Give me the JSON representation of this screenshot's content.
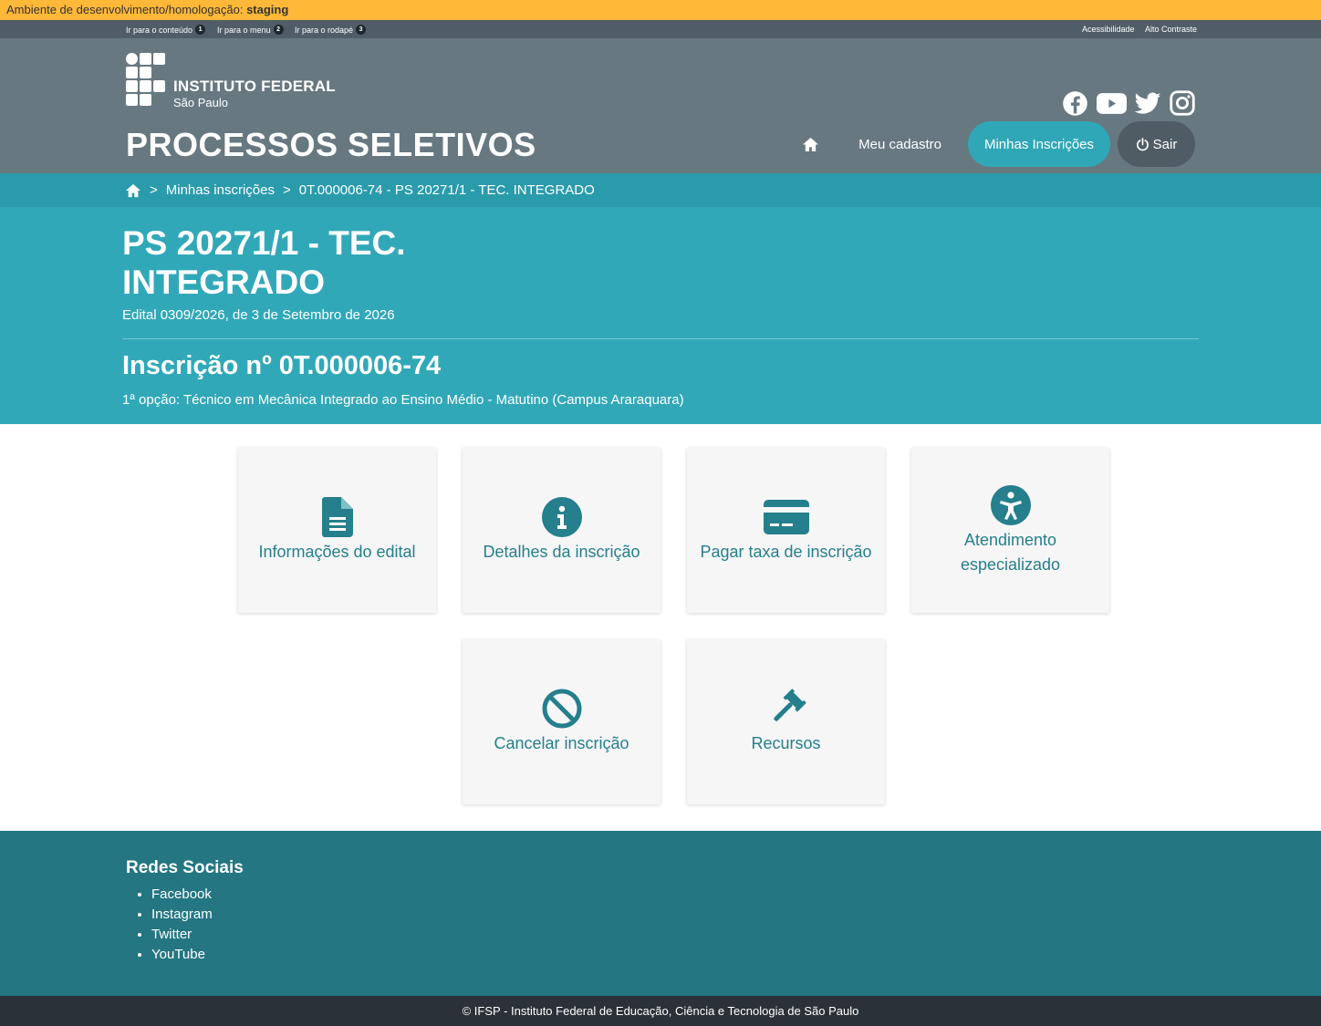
{
  "env": {
    "label": "Ambiente de desenvolvimento/homologação:",
    "value": "staging"
  },
  "skip_links": [
    {
      "label": "Ir para o conteúdo",
      "key": "1"
    },
    {
      "label": "Ir para o menu",
      "key": "2"
    },
    {
      "label": "Ir para o rodapé",
      "key": "3"
    }
  ],
  "utility_links": {
    "accessibility": "Acessibilidade",
    "contrast": "Alto Contraste"
  },
  "logo": {
    "name": "INSTITUTO FEDERAL",
    "campus": "São Paulo"
  },
  "site_title": "PROCESSOS SELETIVOS",
  "nav": {
    "meu_cadastro": "Meu cadastro",
    "minhas_inscricoes": "Minhas Inscrições",
    "sair": "Sair"
  },
  "breadcrumb": {
    "sep": ">",
    "item1": "Minhas inscrições",
    "item2": "0T.000006-74 - PS 20271/1 - TEC. INTEGRADO"
  },
  "hero": {
    "title": "PS 20271/1 - TEC. INTEGRADO",
    "edital": "Edital 0309/2026, de 3 de Setembro de 2026",
    "inscricao": "Inscrição nº 0T.000006-74",
    "opcao": "1ª opção: Técnico em Mecânica Integrado ao Ensino Médio - Matutino (Campus Araraquara)"
  },
  "cards": {
    "edital": "Informações do edital",
    "detalhes": "Detalhes da inscrição",
    "pagar": "Pagar taxa de inscrição",
    "atendimento": "Atendimento especializado",
    "cancelar": "Cancelar inscrição",
    "recursos": "Recursos"
  },
  "footer": {
    "heading": "Redes Sociais",
    "links": [
      "Facebook",
      "Instagram",
      "Twitter",
      "YouTube"
    ],
    "copyright": "© IFSP - Instituto Federal de Educação, Ciência e Tecnologia de São Paulo"
  },
  "colors": {
    "env_bar": "#ffb838",
    "header": "#677881",
    "accent": "#31a8b8",
    "card_text": "#257f8c",
    "footer": "#237682",
    "bottom": "#2b3138"
  }
}
